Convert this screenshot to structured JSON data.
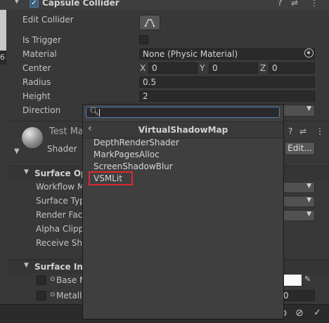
{
  "component": {
    "title": "Capsule Collider",
    "fields": {
      "edit_collider_label": "Edit Collider",
      "is_trigger_label": "Is Trigger",
      "material_label": "Material",
      "material_value": "None (Physic Material)",
      "center_label": "Center",
      "center_x_label": "X",
      "center_x": "0",
      "center_y_label": "Y",
      "center_y": "0",
      "center_z_label": "Z",
      "center_z": "0",
      "radius_label": "Radius",
      "radius_value": "0.5",
      "height_label": "Height",
      "height_value": "2",
      "direction_label": "Direction"
    }
  },
  "material": {
    "name": "Test Ma",
    "shader_label": "Shader",
    "edit_button": "Edit..."
  },
  "surface_options": {
    "title": "Surface Opt",
    "rows": [
      "Workflow M",
      "Surface Typ",
      "Render Face",
      "Alpha Clippi",
      "Receive Sha"
    ]
  },
  "surface_inputs": {
    "title": "Surface Inpu",
    "rows": [
      "Base M",
      "Metalli"
    ],
    "metallic_value": "0"
  },
  "left_edge_text": "6",
  "popup": {
    "search_value": "",
    "header": "VirtualShadowMap",
    "items": [
      "DepthRenderShader",
      "MarkPagesAlloc",
      "ScreenShadowBlur",
      "VSMLit"
    ],
    "highlighted_item": "VSMLit",
    "highlight_color": "#e0282e"
  },
  "icons": {
    "help": "question-icon",
    "presets": "sliders-icon",
    "menu": "kebab-icon"
  }
}
